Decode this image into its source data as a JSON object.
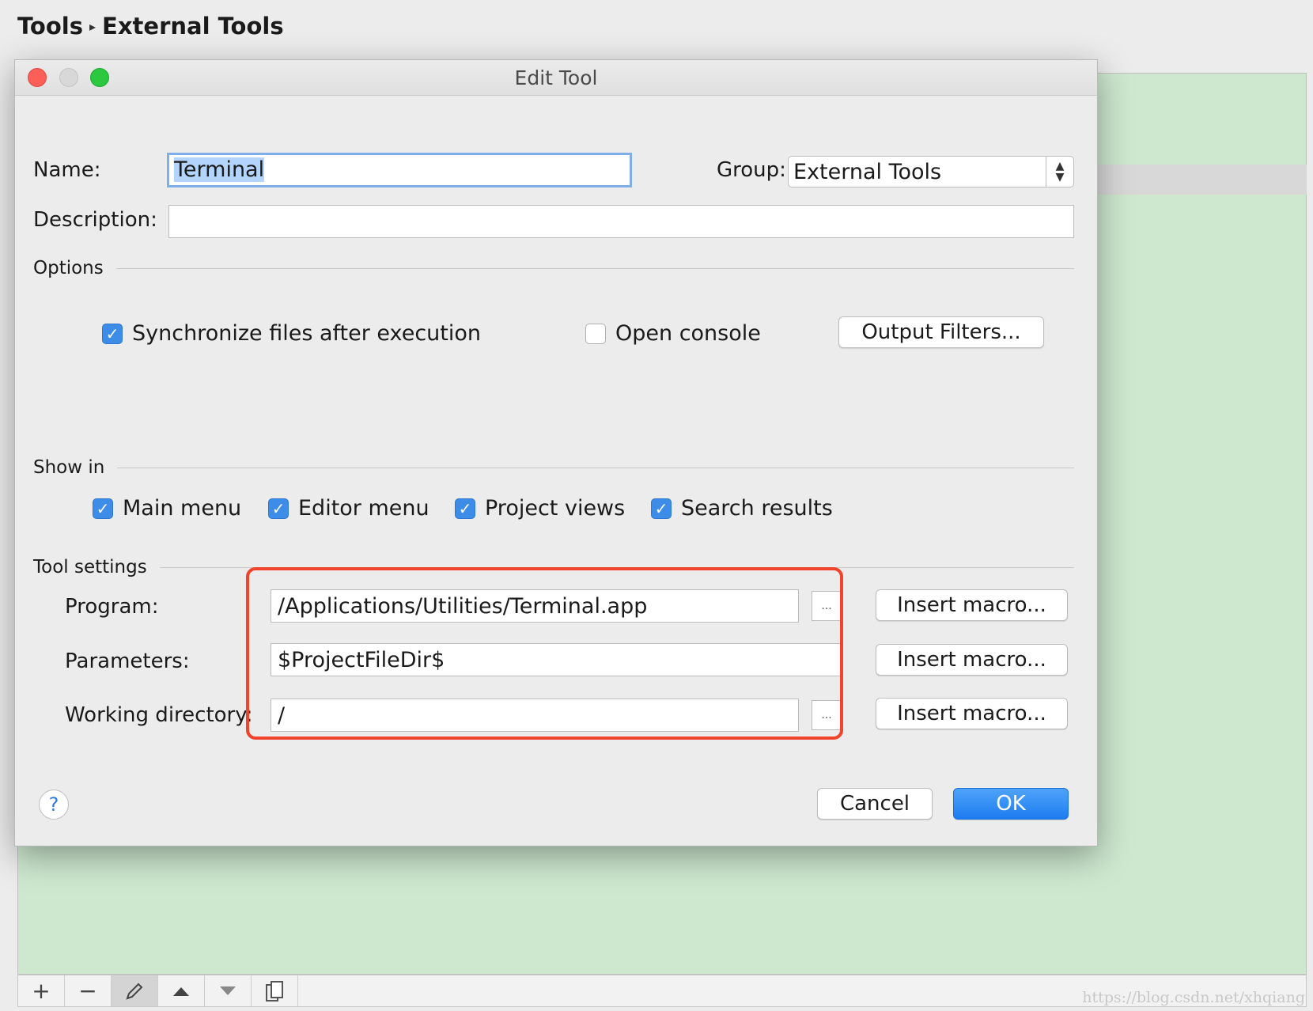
{
  "breadcrumb": {
    "parent": "Tools",
    "separator": "▸",
    "current": "External Tools"
  },
  "dialog": {
    "title": "Edit Tool",
    "name": {
      "label": "Name:",
      "value": "Terminal"
    },
    "group": {
      "label": "Group:",
      "value": "External Tools"
    },
    "description": {
      "label": "Description:",
      "value": ""
    },
    "options": {
      "heading": "Options",
      "sync_files": {
        "label": "Synchronize files after execution",
        "checked": true
      },
      "open_console": {
        "label": "Open console",
        "checked": false
      },
      "output_filters_button": "Output Filters..."
    },
    "show_in": {
      "heading": "Show in",
      "items": [
        {
          "label": "Main menu",
          "checked": true
        },
        {
          "label": "Editor menu",
          "checked": true
        },
        {
          "label": "Project views",
          "checked": true
        },
        {
          "label": "Search results",
          "checked": true
        }
      ]
    },
    "tool_settings": {
      "heading": "Tool settings",
      "program": {
        "label": "Program:",
        "value": "/Applications/Utilities/Terminal.app"
      },
      "parameters": {
        "label": "Parameters:",
        "value": "$ProjectFileDir$"
      },
      "working_directory": {
        "label": "Working directory:",
        "value": "/"
      },
      "browse_label": "...",
      "insert_macro_label": "Insert macro..."
    },
    "help_label": "?",
    "cancel_label": "Cancel",
    "ok_label": "OK"
  },
  "toolbar": {
    "icons": [
      "plus-icon",
      "minus-icon",
      "pencil-icon",
      "arrow-up-icon",
      "arrow-down-icon",
      "copy-icon"
    ]
  },
  "watermark": "https://blog.csdn.net/xhqiang",
  "colors": {
    "accent": "#3d8de8",
    "highlight_box": "#f0442c",
    "background_panel": "#cde8cf"
  }
}
